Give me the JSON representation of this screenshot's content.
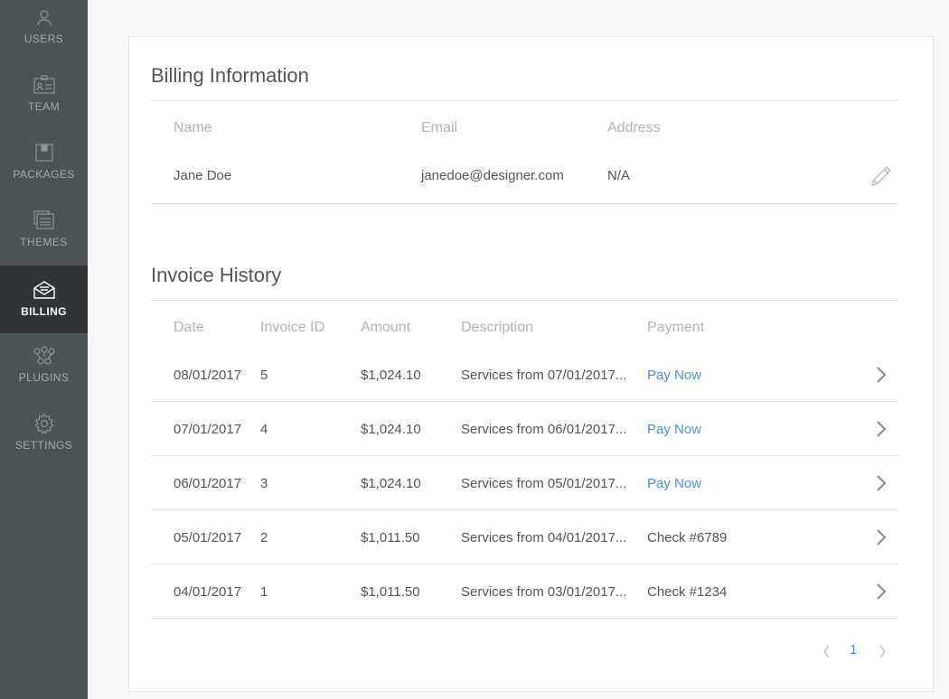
{
  "sidebar": {
    "items": [
      {
        "label": "USERS",
        "icon": "user-icon"
      },
      {
        "label": "TEAM",
        "icon": "id-card-icon"
      },
      {
        "label": "PACKAGES",
        "icon": "package-icon"
      },
      {
        "label": "THEMES",
        "icon": "themes-icon"
      },
      {
        "label": "BILLING",
        "icon": "envelope-icon",
        "active": true
      },
      {
        "label": "PLUGINS",
        "icon": "plugins-icon"
      },
      {
        "label": "SETTINGS",
        "icon": "gear-icon"
      }
    ]
  },
  "billing": {
    "title": "Billing Information",
    "headers": {
      "name": "Name",
      "email": "Email",
      "address": "Address"
    },
    "row": {
      "name": "Jane Doe",
      "email": "janedoe@designer.com",
      "address": "N/A"
    }
  },
  "invoices": {
    "title": "Invoice History",
    "headers": {
      "date": "Date",
      "id": "Invoice ID",
      "amount": "Amount",
      "description": "Description",
      "payment": "Payment"
    },
    "rows": [
      {
        "date": "08/01/2017",
        "id": "5",
        "amount": "$1,024.10",
        "description": "Services from 07/01/2017...",
        "payment": "Pay Now",
        "payment_is_link": true
      },
      {
        "date": "07/01/2017",
        "id": "4",
        "amount": "$1,024.10",
        "description": "Services from 06/01/2017...",
        "payment": "Pay Now",
        "payment_is_link": true
      },
      {
        "date": "06/01/2017",
        "id": "3",
        "amount": "$1,024.10",
        "description": "Services from 05/01/2017...",
        "payment": "Pay Now",
        "payment_is_link": true
      },
      {
        "date": "05/01/2017",
        "id": "2",
        "amount": "$1,011.50",
        "description": "Services from 04/01/2017...",
        "payment": "Check #6789",
        "payment_is_link": false
      },
      {
        "date": "04/01/2017",
        "id": "1",
        "amount": "$1,011.50",
        "description": "Services from 03/01/2017...",
        "payment": "Check #1234",
        "payment_is_link": false
      }
    ]
  },
  "pagination": {
    "prev": "〈",
    "current": "1",
    "next": "〉"
  },
  "colors": {
    "sidebar": "#4c5357",
    "sidebar_active": "#2e3437",
    "link": "#4a90d9"
  }
}
